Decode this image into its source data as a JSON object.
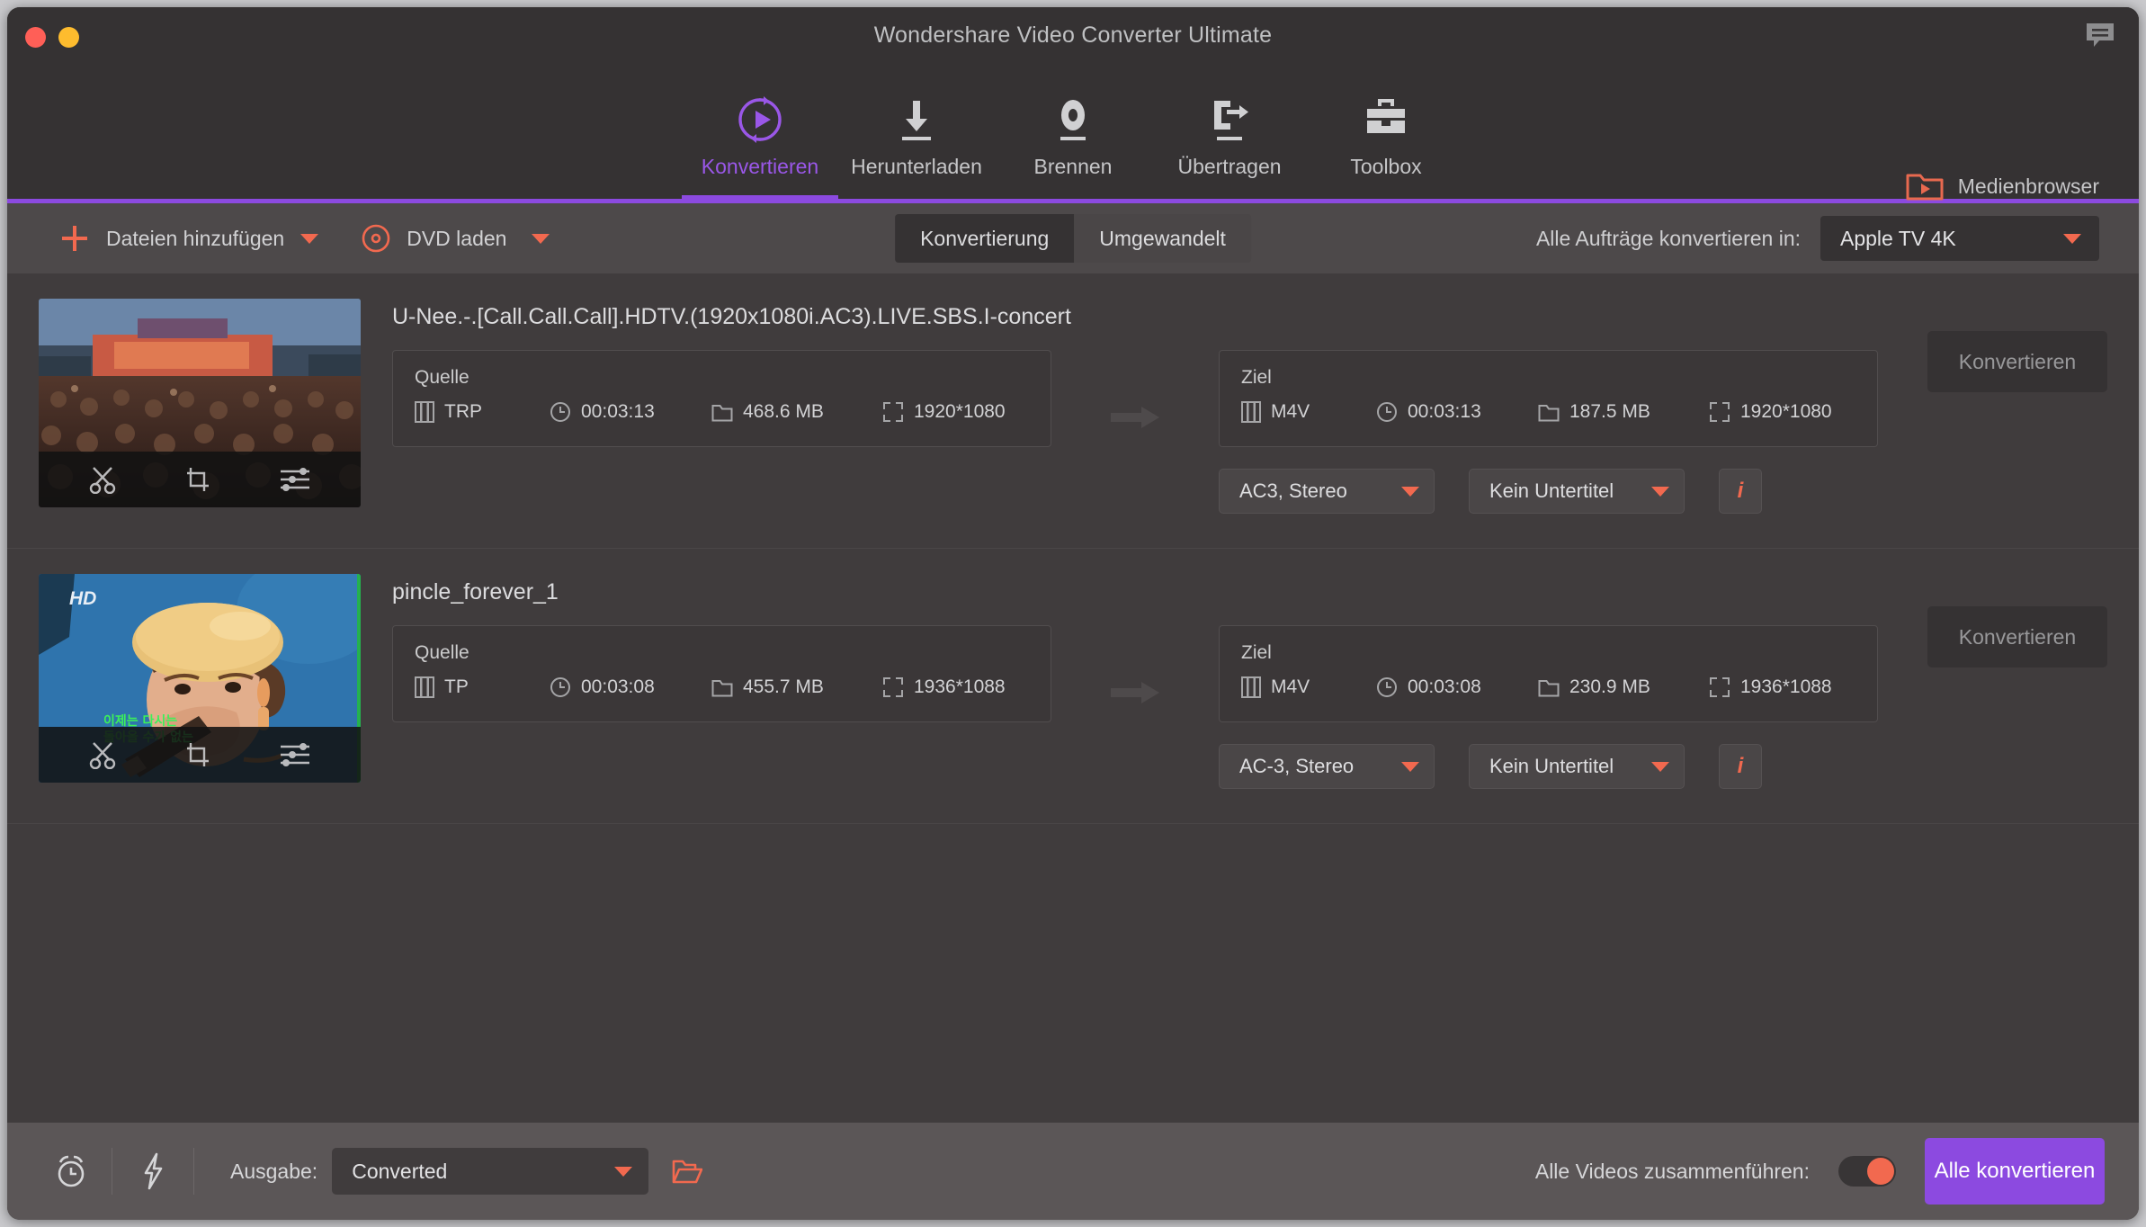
{
  "window": {
    "title": "Wondershare Video Converter Ultimate",
    "traffic_lights": [
      "close",
      "minimize"
    ],
    "feedback_icon": "speech-bubble-icon",
    "accent_purple": "#8c4ae0",
    "accent_orange": "#f2694f"
  },
  "nav": {
    "items": [
      {
        "label": "Konvertieren",
        "icon": "convert-circular-play-icon",
        "active": true
      },
      {
        "label": "Herunterladen",
        "icon": "download-arrow-icon",
        "active": false
      },
      {
        "label": "Brennen",
        "icon": "burn-disc-icon",
        "active": false
      },
      {
        "label": "Übertragen",
        "icon": "transfer-device-arrow-icon",
        "active": false
      },
      {
        "label": "Toolbox",
        "icon": "toolbox-icon",
        "active": false
      }
    ],
    "media_browser": {
      "label": "Medienbrowser",
      "icon": "folder-play-icon"
    }
  },
  "toolbar": {
    "add_files": {
      "label": "Dateien hinzufügen",
      "icon": "plus-icon",
      "caret": "chevron-down-icon"
    },
    "load_dvd": {
      "label": "DVD laden",
      "icon": "disc-icon",
      "caret": "chevron-down-icon"
    },
    "tabs": [
      {
        "label": "Konvertierung",
        "active": true
      },
      {
        "label": "Umgewandelt",
        "active": false
      }
    ],
    "convert_all_label": "Alle Aufträge konvertieren in:",
    "convert_all_value": "Apple TV 4K"
  },
  "labels": {
    "source": "Quelle",
    "target": "Ziel",
    "convert": "Konvertieren",
    "info": "i",
    "arrow": "arrow-right-icon"
  },
  "files": [
    {
      "name": "U-Nee.-.[Call.Call.Call].HDTV.(1920x1080i.AC3).LIVE.SBS.I-concert",
      "thumbnail": "concert-stage-crowd",
      "thumb_tools": [
        "trim-scissors-icon",
        "crop-icon",
        "effects-sliders-icon"
      ],
      "source": {
        "title": "Quelle",
        "format": "TRP",
        "duration": "00:03:13",
        "size": "468.6 MB",
        "resolution": "1920*1080"
      },
      "target": {
        "title": "Ziel",
        "format": "M4V",
        "duration": "00:03:13",
        "size": "187.5 MB",
        "resolution": "1920*1080"
      },
      "audio_track": "AC3, Stereo",
      "subtitle_track": "Kein Untertitel",
      "convert_button": "Konvertieren"
    },
    {
      "name": "pincle_forever_1",
      "thumbnail": "singer-yellow-beret-blue-bg",
      "thumb_tools": [
        "trim-scissors-icon",
        "crop-icon",
        "effects-sliders-icon"
      ],
      "source": {
        "title": "Quelle",
        "format": "TP",
        "duration": "00:03:08",
        "size": "455.7 MB",
        "resolution": "1936*1088"
      },
      "target": {
        "title": "Ziel",
        "format": "M4V",
        "duration": "00:03:08",
        "size": "230.9 MB",
        "resolution": "1936*1088"
      },
      "audio_track": "AC-3, Stereo",
      "subtitle_track": "Kein Untertitel",
      "convert_button": "Konvertieren"
    }
  ],
  "bottom": {
    "scheduler_icon": "alarm-clock-icon",
    "accelerate_icon": "lightning-bolt-icon",
    "output_label": "Ausgabe:",
    "output_value": "Converted",
    "open_folder_icon": "folder-open-icon",
    "merge_label": "Alle Videos zusammenführen:",
    "merge_enabled": true,
    "convert_all_button": "Alle konvertieren"
  }
}
